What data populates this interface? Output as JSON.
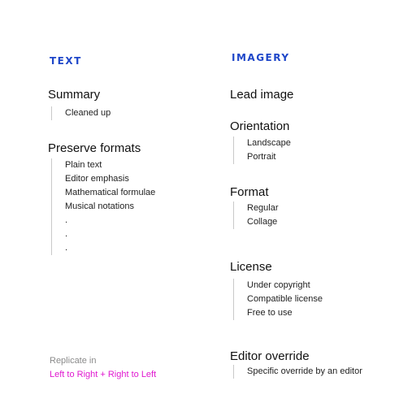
{
  "text_col": {
    "title": "TEXT",
    "summary": {
      "heading": "Summary",
      "items": [
        "Cleaned up"
      ]
    },
    "preserve": {
      "heading": "Preserve formats",
      "items": [
        "Plain text",
        "Editor emphasis",
        "Mathematical formulae",
        "Musical notations",
        ".",
        ".",
        "."
      ]
    }
  },
  "imagery_col": {
    "title": "IMAGERY",
    "lead": {
      "heading": "Lead image"
    },
    "orientation": {
      "heading": "Orientation",
      "items": [
        "Landscape",
        "Portrait"
      ]
    },
    "format": {
      "heading": "Format",
      "items": [
        "Regular",
        "Collage"
      ]
    },
    "license": {
      "heading": "License",
      "items": [
        "Under copyright",
        "Compatible license",
        "Free to use"
      ]
    },
    "override": {
      "heading": "Editor override",
      "items": [
        "Specific override by an editor"
      ]
    }
  },
  "note": {
    "label": "Replicate in",
    "value": "Left to Right + Right to Left"
  },
  "colors": {
    "column_heading": "#1f47c9",
    "highlight": "#e01ad0",
    "muted": "#8a8a8a"
  }
}
